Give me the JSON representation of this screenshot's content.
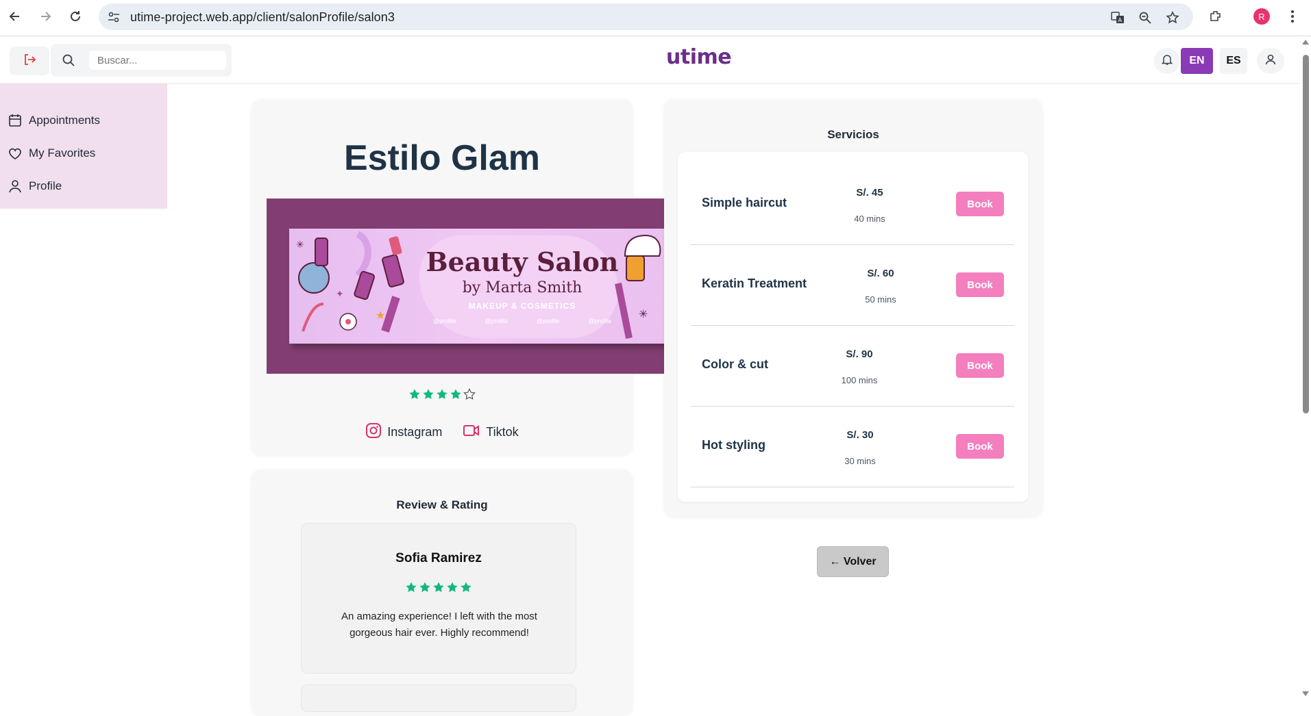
{
  "browser": {
    "url": "utime-project.web.app/client/salonProfile/salon3",
    "profile_initial": "R",
    "icons": [
      "back-icon",
      "forward-icon",
      "reload-icon",
      "site-settings-icon",
      "translate-icon",
      "zoom-icon",
      "bookmark-star-icon",
      "extensions-icon",
      "menu-dots-icon"
    ]
  },
  "header": {
    "search_placeholder": "Buscar...",
    "logo_text": "utime",
    "lang_en": "EN",
    "lang_es": "ES",
    "colors": {
      "accent": "#8a3ab5",
      "logout": "#e53e3e"
    }
  },
  "sidebar": {
    "items": [
      {
        "label": "Appointments",
        "icon": "calendar-icon"
      },
      {
        "label": "My Favorites",
        "icon": "heart-icon"
      },
      {
        "label": "Profile",
        "icon": "user-icon"
      }
    ]
  },
  "salon": {
    "name": "Estilo Glam",
    "rating": 4,
    "rating_max": 5,
    "banner": {
      "title": "Beauty Salon",
      "subtitle": "by Marta Smith",
      "tagline": "MAKEUP & COSMETICS",
      "handles": [
        "@profile",
        "@profile",
        "@profile",
        "@profile"
      ]
    },
    "socials": [
      {
        "label": "Instagram",
        "icon": "instagram-icon"
      },
      {
        "label": "Tiktok",
        "icon": "video-icon"
      }
    ]
  },
  "reviews": {
    "title": "Review & Rating",
    "items": [
      {
        "name": "Sofia Ramirez",
        "rating": 5,
        "text": "An amazing experience! I left with the most gorgeous hair ever. Highly recommend!"
      }
    ]
  },
  "services": {
    "title": "Servicios",
    "book_label": "Book",
    "items": [
      {
        "name": "Simple haircut",
        "price": "S/. 45",
        "duration": "40 mins"
      },
      {
        "name": "Keratin Treatment",
        "price": "S/. 60",
        "duration": "50 mins"
      },
      {
        "name": "Color & cut",
        "price": "S/. 90",
        "duration": "100 mins"
      },
      {
        "name": "Hot styling",
        "price": "S/. 30",
        "duration": "30 mins"
      }
    ]
  },
  "back_label": "← Volver",
  "colors": {
    "star": "#10b981",
    "book": "#f37fbf",
    "sidebar_bg": "#f1dfee"
  }
}
